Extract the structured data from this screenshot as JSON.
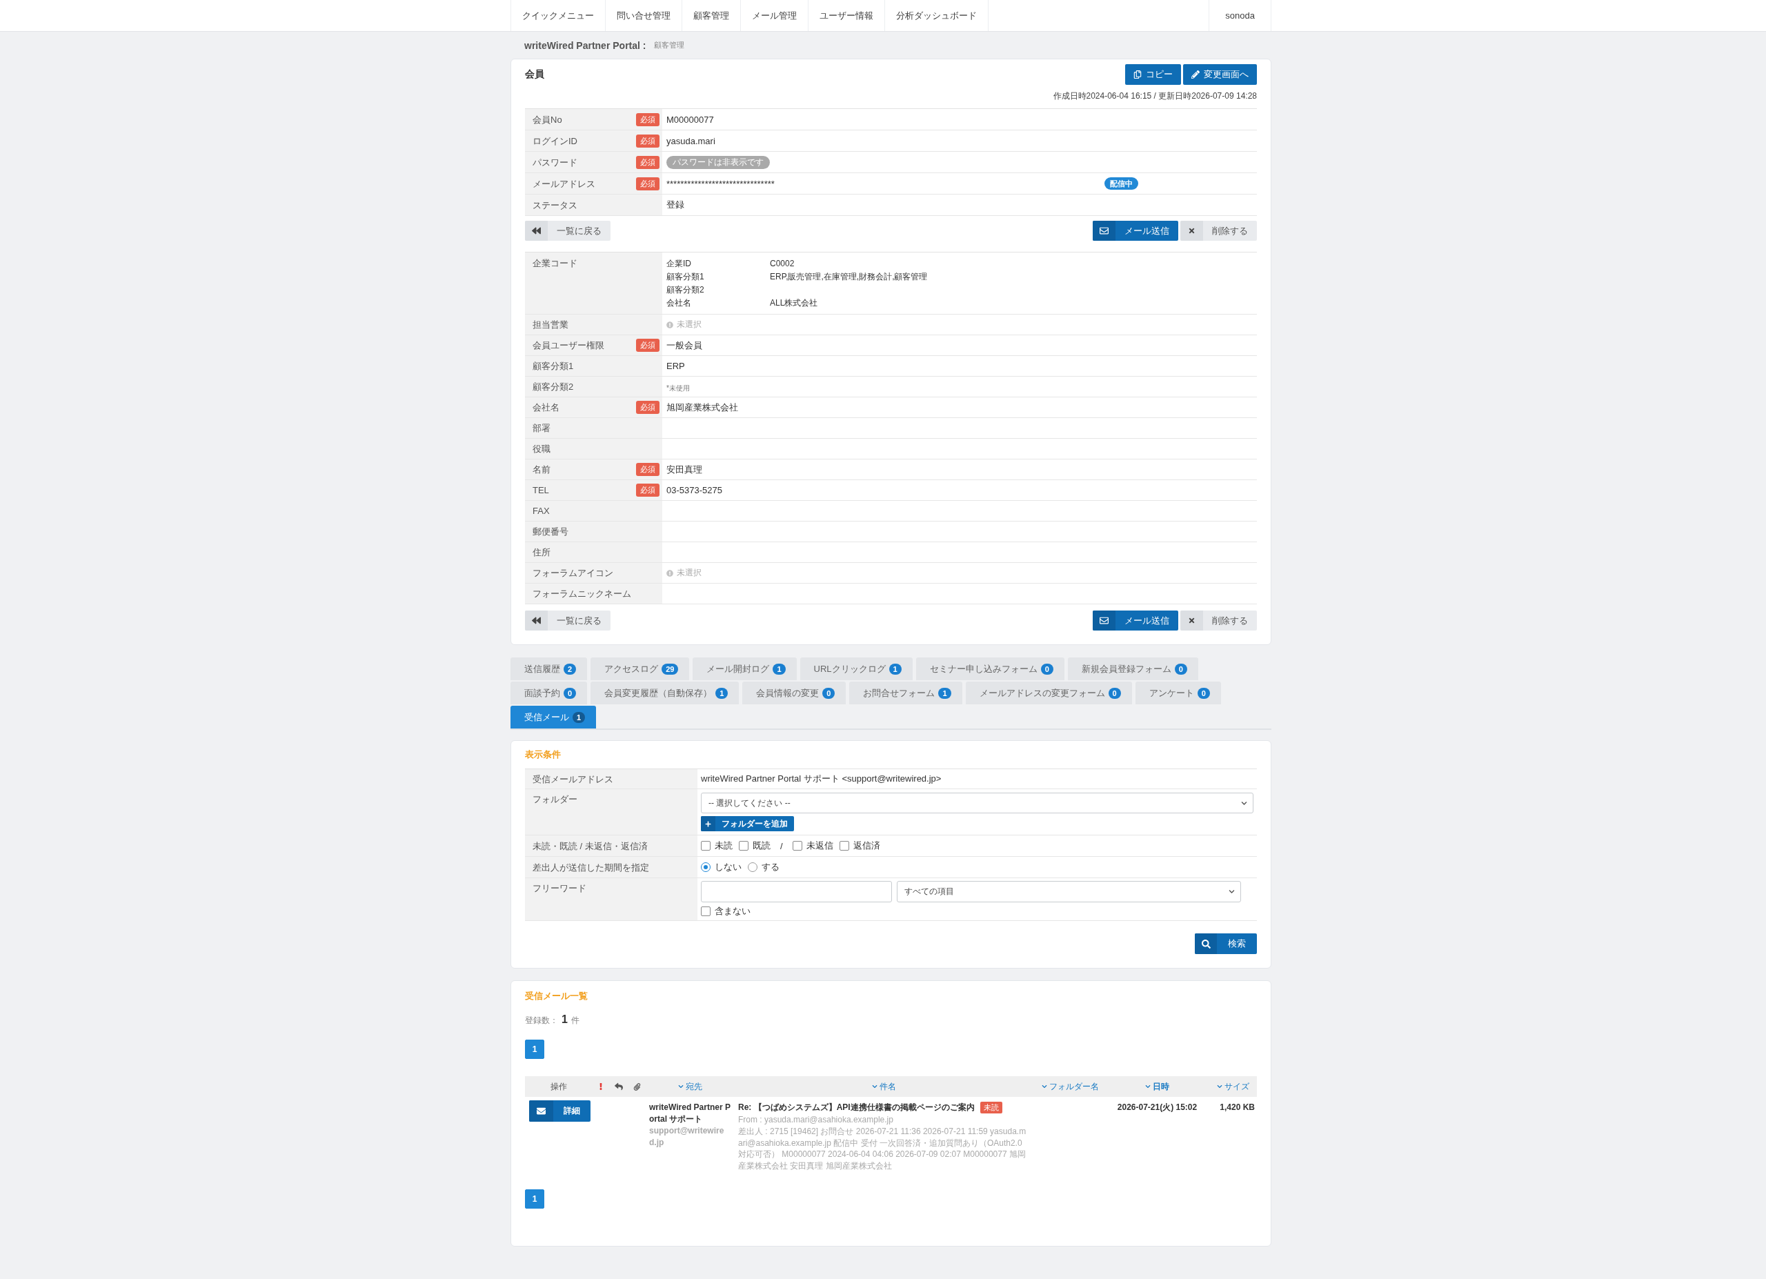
{
  "nav": {
    "items": [
      {
        "label": "クイックメニュー"
      },
      {
        "label": "問い合せ管理"
      },
      {
        "label": "顧客管理"
      },
      {
        "label": "メール管理"
      },
      {
        "label": "ユーザー情報"
      },
      {
        "label": "分析ダッシュボード"
      }
    ],
    "user": "sonoda"
  },
  "breadcrumb": {
    "site": "writeWired Partner Portal :",
    "page": "顧客管理"
  },
  "member": {
    "title": "会員",
    "buttons": [
      {
        "kind": "copy",
        "label": "コピー"
      },
      {
        "kind": "edit",
        "label": "変更画面へ"
      }
    ],
    "timestamps": "作成日時2024-06-04 16:15 / 更新日時2026-07-09 14:28",
    "fields": [
      {
        "kind": "text",
        "label": "会員No",
        "required_badge": "必須",
        "value": "M00000077"
      },
      {
        "kind": "text",
        "label": "ログインID",
        "required_badge": "必須",
        "value": "yasuda.mari"
      },
      {
        "kind": "pill",
        "label": "パスワード",
        "required_badge": "必須",
        "value": "パスワードは非表示です"
      },
      {
        "kind": "masked",
        "label": "メールアドレス",
        "required_badge": "必須",
        "value": "*******************************",
        "status": "配信中"
      },
      {
        "kind": "text",
        "label": "ステータス",
        "value": "登録"
      }
    ],
    "actions_top": [
      {
        "kind": "back",
        "label": "一覧に戻る"
      },
      {
        "kind": "mail",
        "label": "メール送信"
      },
      {
        "kind": "delete",
        "label": "削除する"
      }
    ],
    "company": {
      "label": "企業コード",
      "details": [
        {
          "key": "企業ID",
          "value": "C0002"
        },
        {
          "key": "顧客分類1",
          "value": "ERP,販売管理,在庫管理,財務会計,顧客管理"
        },
        {
          "key": "顧客分類2"
        },
        {
          "key": "会社名",
          "value": "ALL株式会社"
        }
      ]
    },
    "more_fields": [
      {
        "kind": "unselected",
        "label": "担当営業",
        "value": "未選択"
      },
      {
        "kind": "text",
        "label": "会員ユーザー権限",
        "required_badge": "必須",
        "value": "一般会員"
      },
      {
        "kind": "text",
        "label": "顧客分類1",
        "value": "ERP"
      },
      {
        "kind": "note",
        "label": "顧客分類2",
        "value": "*未使用"
      },
      {
        "kind": "text",
        "label": "会社名",
        "required_badge": "必須",
        "value": "旭岡産業株式会社"
      },
      {
        "kind": "text",
        "label": "部署"
      },
      {
        "kind": "text",
        "label": "役職"
      },
      {
        "kind": "text",
        "label": "名前",
        "required_badge": "必須",
        "value": "安田真理"
      },
      {
        "kind": "text",
        "label": "TEL",
        "required_badge": "必須",
        "value": "03-5373-5275"
      },
      {
        "kind": "text",
        "label": "FAX"
      },
      {
        "kind": "text",
        "label": "郵便番号"
      },
      {
        "kind": "text",
        "label": "住所"
      },
      {
        "kind": "unselected",
        "label": "フォーラムアイコン",
        "value": "未選択"
      },
      {
        "kind": "text",
        "label": "フォーラムニックネーム"
      }
    ],
    "actions_bottom": [
      {
        "kind": "back",
        "label": "一覧に戻る"
      },
      {
        "kind": "mail",
        "label": "メール送信"
      },
      {
        "kind": "delete",
        "label": "削除する"
      }
    ]
  },
  "tab_rows": [
    {
      "tabs": [
        {
          "label": "送信履歴",
          "count": "2",
          "selected": false
        },
        {
          "label": "アクセスログ",
          "count": "29",
          "selected": false
        },
        {
          "label": "メール開封ログ",
          "count": "1",
          "selected": false
        },
        {
          "label": "URLクリックログ",
          "count": "1",
          "selected": false
        },
        {
          "label": "セミナー申し込みフォーム",
          "count": "0",
          "selected": false
        },
        {
          "label": "新規会員登録フォーム",
          "count": "0",
          "selected": false
        }
      ]
    },
    {
      "tabs": [
        {
          "label": "面談予約",
          "count": "0",
          "selected": false
        },
        {
          "label": "会員変更履歴（自動保存）",
          "count": "1",
          "selected": false
        },
        {
          "label": "会員情報の変更",
          "count": "0",
          "selected": false
        },
        {
          "label": "お問合せフォーム",
          "count": "1",
          "selected": false
        },
        {
          "label": "メールアドレスの変更フォーム",
          "count": "0",
          "selected": false
        },
        {
          "label": "アンケート",
          "count": "0",
          "selected": false
        }
      ]
    },
    {
      "tabs": [
        {
          "label": "受信メール",
          "count": "1",
          "selected": true
        }
      ]
    }
  ],
  "filter": {
    "title": "表示条件",
    "rows": [
      {
        "kind": "text",
        "label": "受信メールアドレス",
        "value": "writeWired Partner Portal サポート <support@writewired.jp>"
      },
      {
        "kind": "folder",
        "label": "フォルダー",
        "select": "-- 選択してください --",
        "button": "フォルダーを追加"
      },
      {
        "kind": "checks",
        "label": "未読・既読 / 未返信・返信済",
        "separator": "/",
        "groups": [
          {
            "options": [
              {
                "label": "未読",
                "checked": false
              },
              {
                "label": "既読",
                "checked": false
              }
            ]
          },
          {
            "options": [
              {
                "label": "未返信",
                "checked": false
              },
              {
                "label": "返信済",
                "checked": false
              }
            ]
          }
        ]
      },
      {
        "kind": "radios",
        "label": "差出人が送信した期間を指定",
        "options": [
          {
            "label": "しない",
            "selected": true
          },
          {
            "label": "する",
            "selected": false
          }
        ]
      },
      {
        "kind": "freeword",
        "label": "フリーワード",
        "select": "すべての項目",
        "exclude": {
          "label": "含まない",
          "checked": false
        }
      }
    ],
    "search_button": "検索"
  },
  "mail_list": {
    "title": "受信メール一覧",
    "count_label": "登録数：",
    "count": "1",
    "count_unit": "件",
    "pages_top": [
      {
        "label": "1",
        "selected": true
      }
    ],
    "columns": [
      {
        "kind": "plain",
        "label": "操作"
      },
      {
        "kind": "sort",
        "label": "宛先",
        "active": false
      },
      {
        "kind": "sort",
        "label": "件名",
        "active": false
      },
      {
        "kind": "sort",
        "label": "フォルダー名",
        "active": false
      },
      {
        "kind": "sort",
        "label": "日時",
        "active": true
      },
      {
        "kind": "sort",
        "label": "サイズ",
        "active": false
      }
    ],
    "rows": [
      {
        "action": "詳細",
        "to_name": "writeWired Partner Portal サポート",
        "to_address": "support@writewired.jp",
        "subject": "Re: 【つばめシステムズ】API連携仕様書の掲載ページのご案内",
        "status": "未読",
        "from": "From : yasuda.mari@asahioka.example.jp",
        "excerpt": "差出人 : 2715 [19462] お問合せ 2026-07-21 11:36 2026-07-21 11:59 yasuda.mari@asahioka.example.jp 配信中 受付 一次回答済・追加質問あり（OAuth2.0対応可否） M00000077 2024-06-04 04:06 2026-07-09 02:07 M00000077 旭岡産業株式会社 安田真理 旭岡産業株式会社",
        "date": "2026-07-21(火) 15:02",
        "size": "1,420 KB"
      }
    ],
    "pages_bottom": [
      {
        "label": "1",
        "selected": true
      }
    ]
  }
}
